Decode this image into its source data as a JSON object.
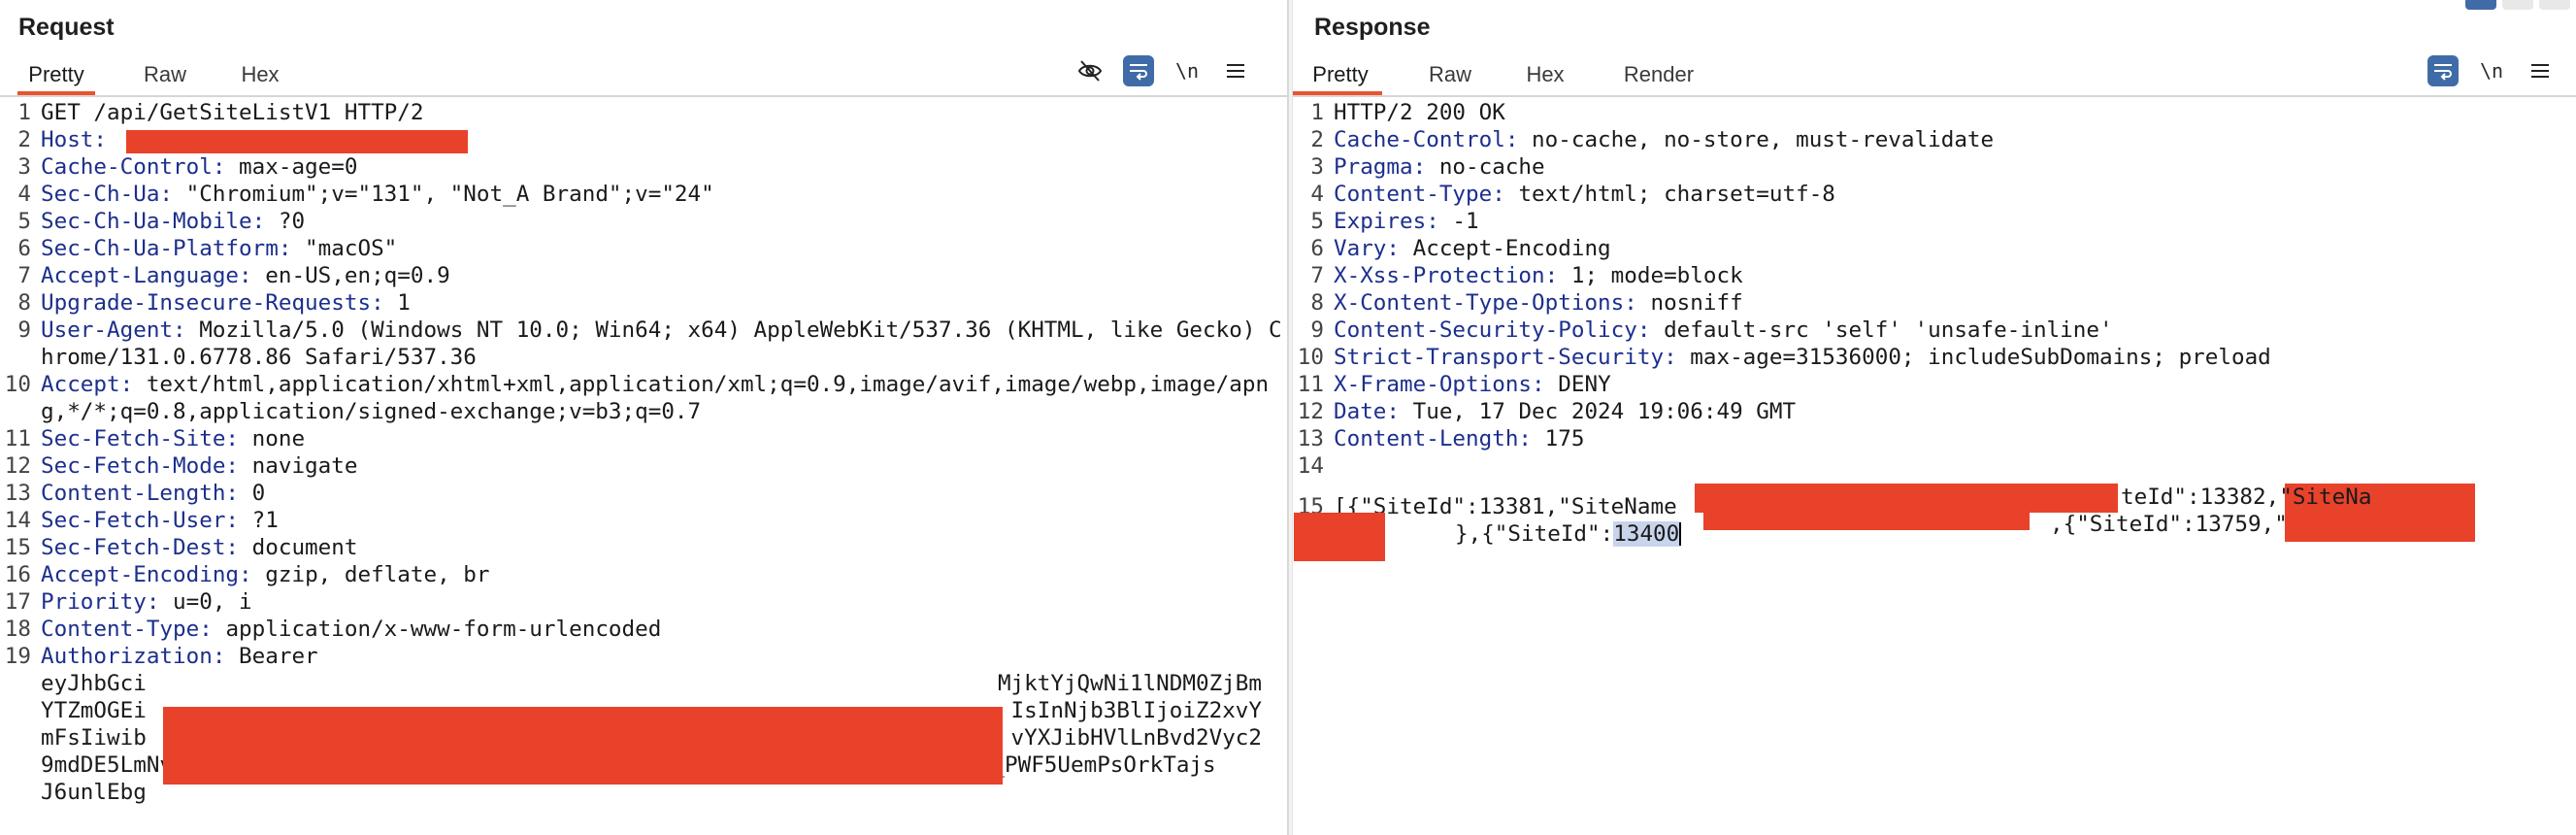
{
  "request": {
    "title": "Request",
    "tabs": [
      {
        "label": "Pretty",
        "active": true
      },
      {
        "label": "Raw",
        "active": false
      },
      {
        "label": "Hex",
        "active": false
      }
    ],
    "tools": {
      "hide_icon": "eye-slash-icon",
      "wrap_icon": "word-wrap-icon",
      "newline_label": "\\n",
      "menu_icon": "hamburger-menu-icon"
    },
    "lines": [
      {
        "n": "1",
        "name": "",
        "value": "GET /api/GetSiteListV1 HTTP/2"
      },
      {
        "n": "2",
        "name": "Host:",
        "value": ""
      },
      {
        "n": "3",
        "name": "Cache-Control:",
        "value": " max-age=0"
      },
      {
        "n": "4",
        "name": "Sec-Ch-Ua:",
        "value": " \"Chromium\";v=\"131\", \"Not_A Brand\";v=\"24\""
      },
      {
        "n": "5",
        "name": "Sec-Ch-Ua-Mobile:",
        "value": " ?0"
      },
      {
        "n": "6",
        "name": "Sec-Ch-Ua-Platform:",
        "value": " \"macOS\""
      },
      {
        "n": "7",
        "name": "Accept-Language:",
        "value": " en-US,en;q=0.9"
      },
      {
        "n": "8",
        "name": "Upgrade-Insecure-Requests:",
        "value": " 1"
      },
      {
        "n": "9",
        "name": "User-Agent:",
        "value": " Mozilla/5.0 (Windows NT 10.0; Win64; x64) AppleWebKit/537.36 (KHTML, like Gecko) Chrome/131.0.6778.86 Safari/537.36"
      },
      {
        "n": "10",
        "name": "Accept:",
        "value": " text/html,application/xhtml+xml,application/xml;q=0.9,image/avif,image/webp,image/apng,*/*;q=0.8,application/signed-exchange;v=b3;q=0.7"
      },
      {
        "n": "11",
        "name": "Sec-Fetch-Site:",
        "value": " none"
      },
      {
        "n": "12",
        "name": "Sec-Fetch-Mode:",
        "value": " navigate"
      },
      {
        "n": "13",
        "name": "Content-Length:",
        "value": " 0"
      },
      {
        "n": "14",
        "name": "Sec-Fetch-User:",
        "value": " ?1"
      },
      {
        "n": "15",
        "name": "Sec-Fetch-Dest:",
        "value": " document"
      },
      {
        "n": "16",
        "name": "Accept-Encoding:",
        "value": " gzip, deflate, br"
      },
      {
        "n": "17",
        "name": "Priority:",
        "value": " u=0, i"
      },
      {
        "n": "18",
        "name": "Content-Type:",
        "value": " application/x-www-form-urlencoded"
      },
      {
        "n": "19",
        "name": "Authorization:",
        "value": " Bearer"
      }
    ],
    "auth_token_lines": [
      "eyJhbGci",
      "YTZmOGEi",
      "mFsIiwib",
      "9mdDE5LmNvbS8iLCJhdWQiOiIqLmN0aWRlb25pbG0taWQuY29tIn0.3tQDQH0aZ43E2mdU3m_PWF5UemPsOrkTajs",
      "J6unlEbg"
    ],
    "auth_token_tails": [
      "MjktYjQwNi1lNDM0ZjBm",
      "IsInNjb3BlIjoiZ2xvY",
      "vYXJibHVlLnBvd2Vyc2",
      "",
      ""
    ]
  },
  "response": {
    "title": "Response",
    "tabs": [
      {
        "label": "Pretty",
        "active": true
      },
      {
        "label": "Raw",
        "active": false
      },
      {
        "label": "Hex",
        "active": false
      },
      {
        "label": "Render",
        "active": false
      }
    ],
    "tools": {
      "wrap_icon": "word-wrap-icon",
      "newline_label": "\\n",
      "menu_icon": "hamburger-menu-icon"
    },
    "lines": [
      {
        "n": "1",
        "name": "",
        "value": "HTTP/2 200 OK"
      },
      {
        "n": "2",
        "name": "Cache-Control:",
        "value": " no-cache, no-store, must-revalidate"
      },
      {
        "n": "3",
        "name": "Pragma:",
        "value": " no-cache"
      },
      {
        "n": "4",
        "name": "Content-Type:",
        "value": " text/html; charset=utf-8"
      },
      {
        "n": "5",
        "name": "Expires:",
        "value": " -1"
      },
      {
        "n": "6",
        "name": "Vary:",
        "value": " Accept-Encoding"
      },
      {
        "n": "7",
        "name": "X-Xss-Protection:",
        "value": " 1; mode=block"
      },
      {
        "n": "8",
        "name": "X-Content-Type-Options:",
        "value": " nosniff"
      },
      {
        "n": "9",
        "name": "Content-Security-Policy:",
        "value": " default-src 'self' 'unsafe-inline'"
      },
      {
        "n": "10",
        "name": "Strict-Transport-Security:",
        "value": " max-age=31536000; includeSubDomains; preload"
      },
      {
        "n": "11",
        "name": "X-Frame-Options:",
        "value": " DENY"
      },
      {
        "n": "12",
        "name": "Date:",
        "value": " Tue, 17 Dec 2024 19:06:49 GMT"
      },
      {
        "n": "13",
        "name": "Content-Length:",
        "value": " 175"
      },
      {
        "n": "14",
        "name": "",
        "value": ""
      }
    ],
    "body": {
      "n": "15",
      "part1": "[{\"SiteId\":13381,\"SiteName",
      "part2": "teId\":13382,\"SiteNa",
      "part3": "},{\"SiteId\":",
      "selected": "13400",
      "part4": ",{\"SiteId\":13759,\""
    }
  }
}
